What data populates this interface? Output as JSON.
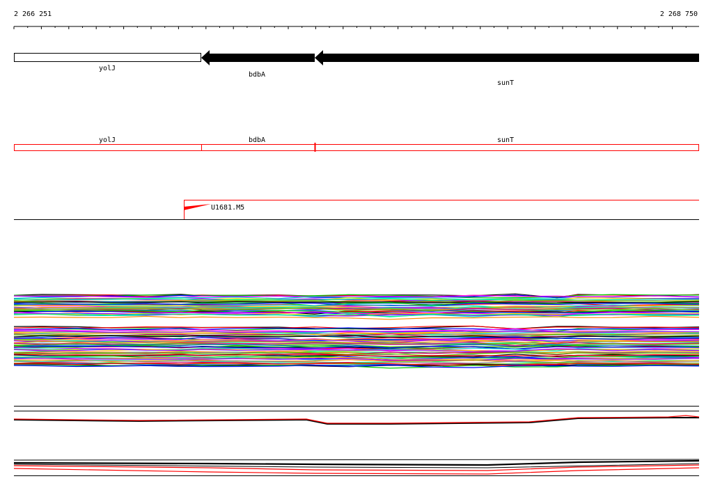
{
  "ruler": {
    "start_label": "2 266 251",
    "end_label": "2 268 750"
  },
  "genes": [
    {
      "name": "yolJ",
      "style": "open"
    },
    {
      "name": "bdbA",
      "style": "filled-arrow-left"
    },
    {
      "name": "sunT",
      "style": "filled-arrow-left"
    }
  ],
  "transcripts": [
    {
      "name": "yolJ"
    },
    {
      "name": "bdbA"
    },
    {
      "name": "sunT"
    }
  ],
  "promoter": {
    "label": "U1681.M5"
  },
  "colors": {
    "feature_line": "#ff0000",
    "gene_fill": "#000000",
    "axis": "#000000",
    "expression_palette": [
      "#000000",
      "#ff0000",
      "#00cc00",
      "#0000ff",
      "#ff00ff",
      "#00cccc",
      "#ffcc00",
      "#8800ff",
      "#00ff88",
      "#ff8800",
      "#888888",
      "#cc0066",
      "#66cc00",
      "#0066cc"
    ]
  }
}
